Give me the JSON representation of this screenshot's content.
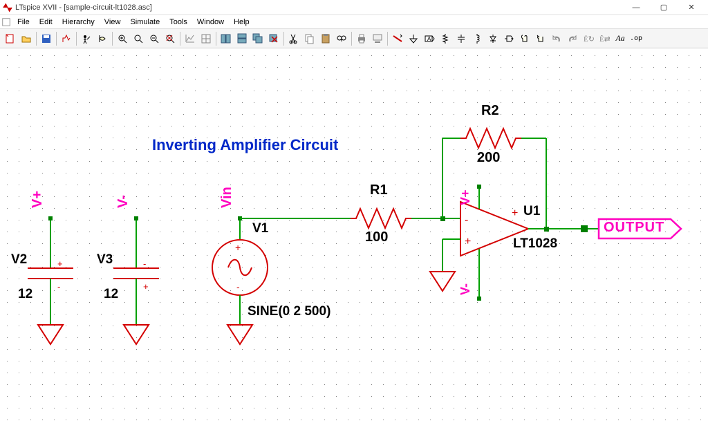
{
  "app": {
    "title": "LTspice XVII - [sample-circuit-lt1028.asc]"
  },
  "menu": {
    "items": [
      "File",
      "Edit",
      "Hierarchy",
      "View",
      "Simulate",
      "Tools",
      "Window",
      "Help"
    ]
  },
  "circuit": {
    "title": "Inverting Amplifier Circuit",
    "output_label": "OUTPUT",
    "components": {
      "V1": {
        "ref": "V1",
        "value": "SINE(0 2 500)",
        "net_label": "Vin"
      },
      "V2": {
        "ref": "V2",
        "value": "12",
        "net_label": "V+"
      },
      "V3": {
        "ref": "V3",
        "value": "12",
        "net_label": "V-"
      },
      "R1": {
        "ref": "R1",
        "value": "100"
      },
      "R2": {
        "ref": "R2",
        "value": "200"
      },
      "U1": {
        "ref": "U1",
        "model": "LT1028",
        "vplus_label": "V+",
        "vminus_label": "V-"
      }
    }
  },
  "colors": {
    "wire": "#00a000",
    "component": "#d40000",
    "net": "#ff00c0",
    "title": "#0028c8",
    "node": "#008000"
  }
}
